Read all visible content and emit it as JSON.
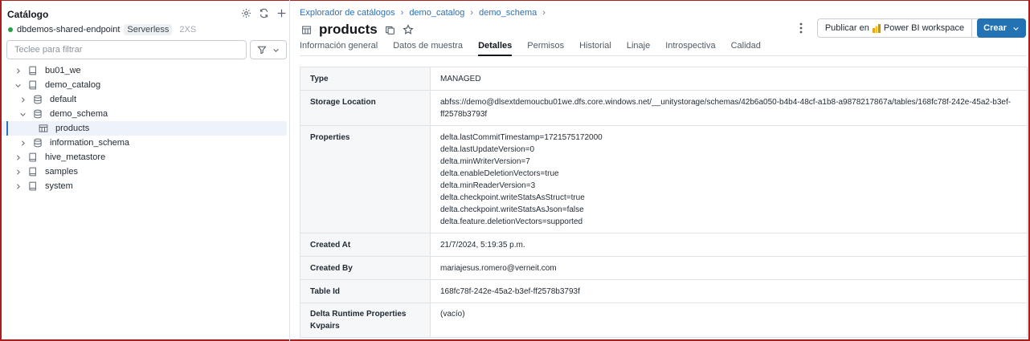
{
  "sidebar": {
    "title": "Catálogo",
    "endpoint": {
      "name": "dbdemos-shared-endpoint",
      "badge": "Serverless",
      "size": "2XS",
      "status_color": "#2a9d4b"
    },
    "filter_placeholder": "Teclee para filtrar",
    "tree": [
      {
        "label": "bu01_we",
        "icon": "catalog-icon",
        "level": 0,
        "expanded": false
      },
      {
        "label": "demo_catalog",
        "icon": "catalog-icon",
        "level": 0,
        "expanded": true
      },
      {
        "label": "default",
        "icon": "schema-icon",
        "level": 1,
        "expanded": false
      },
      {
        "label": "demo_schema",
        "icon": "schema-icon",
        "level": 1,
        "expanded": true
      },
      {
        "label": "products",
        "icon": "table-icon",
        "level": 2,
        "selected": true
      },
      {
        "label": "information_schema",
        "icon": "schema-icon",
        "level": 1,
        "expanded": false
      },
      {
        "label": "hive_metastore",
        "icon": "catalog-icon",
        "level": 0,
        "expanded": false
      },
      {
        "label": "samples",
        "icon": "catalog-icon",
        "level": 0,
        "expanded": false
      },
      {
        "label": "system",
        "icon": "catalog-icon",
        "level": 0,
        "expanded": false
      }
    ]
  },
  "breadcrumb": [
    "Explorador de catálogos",
    "demo_catalog",
    "demo_schema"
  ],
  "header": {
    "title": "products",
    "publish_label": "Publicar en",
    "publish_target": "Power BI workspace",
    "create_label": "Crear",
    "accent": "#2272b4"
  },
  "tabs": [
    {
      "label": "Información general",
      "active": false
    },
    {
      "label": "Datos de muestra",
      "active": false
    },
    {
      "label": "Detalles",
      "active": true
    },
    {
      "label": "Permisos",
      "active": false
    },
    {
      "label": "Historial",
      "active": false
    },
    {
      "label": "Linaje",
      "active": false
    },
    {
      "label": "Introspectiva",
      "active": false
    },
    {
      "label": "Calidad",
      "active": false
    }
  ],
  "details": [
    {
      "key": "Type",
      "value": [
        "MANAGED"
      ]
    },
    {
      "key": "Storage Location",
      "value": [
        "abfss://demo@dlsextdemoucbu01we.dfs.core.windows.net/__unitystorage/schemas/42b6a050-b4b4-48cf-a1b8-a9878217867a/tables/168fc78f-242e-45a2-b3ef-",
        "ff2578b3793f"
      ]
    },
    {
      "key": "Properties",
      "value": [
        "delta.lastCommitTimestamp=1721575172000",
        "delta.lastUpdateVersion=0",
        "delta.minWriterVersion=7",
        "delta.enableDeletionVectors=true",
        "delta.minReaderVersion=3",
        "delta.checkpoint.writeStatsAsStruct=true",
        "delta.checkpoint.writeStatsAsJson=false",
        "delta.feature.deletionVectors=supported"
      ]
    },
    {
      "key": "Created At",
      "value": [
        "21/7/2024, 5:19:35 p.m."
      ]
    },
    {
      "key": "Created By",
      "value": [
        "mariajesus.romero@verneit.com"
      ]
    },
    {
      "key": "Table Id",
      "value": [
        "168fc78f-242e-45a2-b3ef-ff2578b3793f"
      ]
    },
    {
      "key": "Delta Runtime Properties Kvpairs",
      "key_lines": [
        "Delta Runtime Properties",
        "Kvpairs"
      ],
      "value": [
        "(vacío)"
      ]
    }
  ]
}
